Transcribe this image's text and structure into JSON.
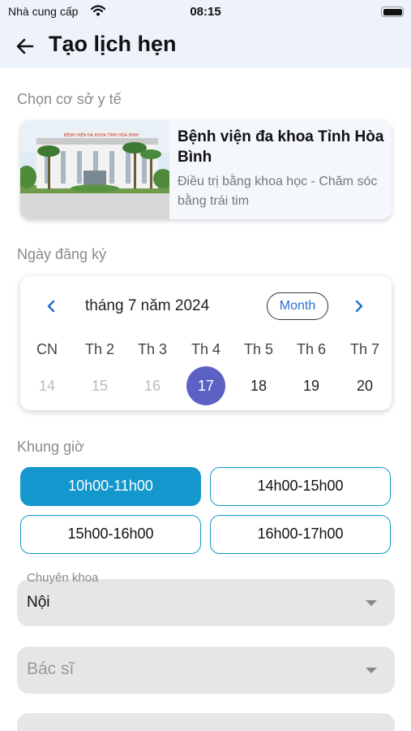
{
  "status_bar": {
    "carrier": "Nhà cung cấp",
    "time": "08:15"
  },
  "header": {
    "title": "Tạo lịch hẹn"
  },
  "facility_section": {
    "label": "Chọn cơ sở y tế",
    "card": {
      "name": "Bệnh viện đa khoa Tỉnh Hòa Bình",
      "slogan": "Điều trị bằng khoa học - Chăm sóc bằng trái tim"
    }
  },
  "date_section": {
    "label": "Ngày đăng ký",
    "calendar": {
      "month_title": "tháng 7 năm 2024",
      "mode_button": "Month",
      "weekdays": [
        "CN",
        "Th 2",
        "Th 3",
        "Th 4",
        "Th 5",
        "Th 6",
        "Th 7"
      ],
      "days": [
        "14",
        "15",
        "16",
        "17",
        "18",
        "19",
        "20"
      ],
      "selected_day": "17"
    }
  },
  "time_section": {
    "label": "Khung giờ",
    "slots": [
      "10h00-11h00",
      "14h00-15h00",
      "15h00-16h00",
      "16h00-17h00"
    ],
    "selected_slot": "10h00-11h00"
  },
  "specialty": {
    "label": "Chuyên khoa",
    "value": "Nội"
  },
  "doctor": {
    "placeholder": "Bác sĩ"
  },
  "colors": {
    "accent": "#1497cc",
    "selected_day": "#5b62c4",
    "header_bg": "#eef3fb"
  }
}
